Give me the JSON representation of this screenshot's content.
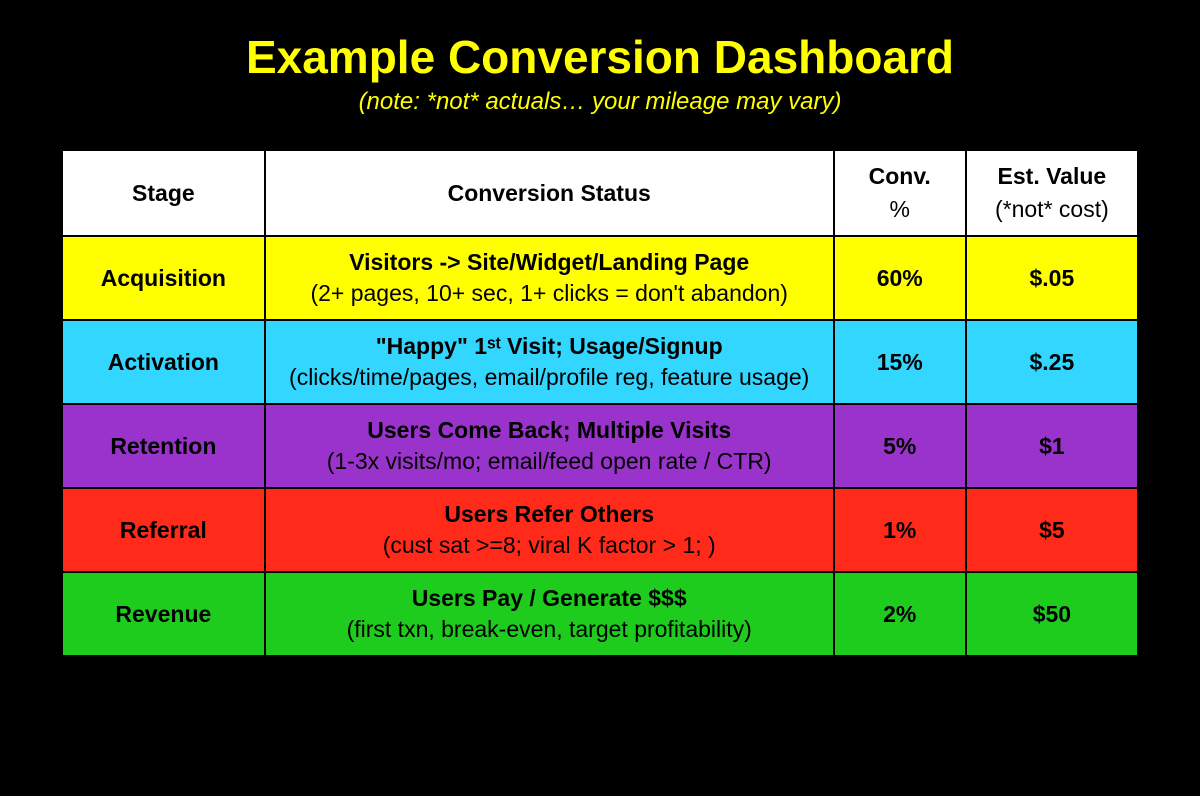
{
  "title": "Example Conversion Dashboard",
  "subtitle": "(note: *not* actuals… your mileage may vary)",
  "headers": {
    "stage": "Stage",
    "status": "Conversion Status",
    "conv_line1": "Conv.",
    "conv_line2": "%",
    "value_line1": "Est. Value",
    "value_line2": "(*not* cost)"
  },
  "rows": [
    {
      "key": "acquisition",
      "stage": "Acquisition",
      "status_main": "Visitors -> Site/Widget/Landing Page",
      "status_sub": "(2+ pages, 10+ sec, 1+ clicks = don't abandon)",
      "conv": "60%",
      "value": "$.05"
    },
    {
      "key": "activation",
      "stage": "Activation",
      "status_main": "\"Happy\" 1ˢᵗ Visit; Usage/Signup",
      "status_sub": "(clicks/time/pages, email/profile reg, feature usage)",
      "conv": "15%",
      "value": "$.25"
    },
    {
      "key": "retention",
      "stage": "Retention",
      "status_main": "Users Come Back; Multiple Visits",
      "status_sub": "(1-3x visits/mo; email/feed open rate / CTR)",
      "conv": "5%",
      "value": "$1"
    },
    {
      "key": "referral",
      "stage": "Referral",
      "status_main": "Users Refer Others",
      "status_sub": "(cust sat >=8; viral K factor > 1; )",
      "conv": "1%",
      "value": "$5"
    },
    {
      "key": "revenue",
      "stage": "Revenue",
      "status_main": "Users Pay / Generate $$$",
      "status_sub": "(first txn, break-even, target profitability)",
      "conv": "2%",
      "value": "$50"
    }
  ]
}
